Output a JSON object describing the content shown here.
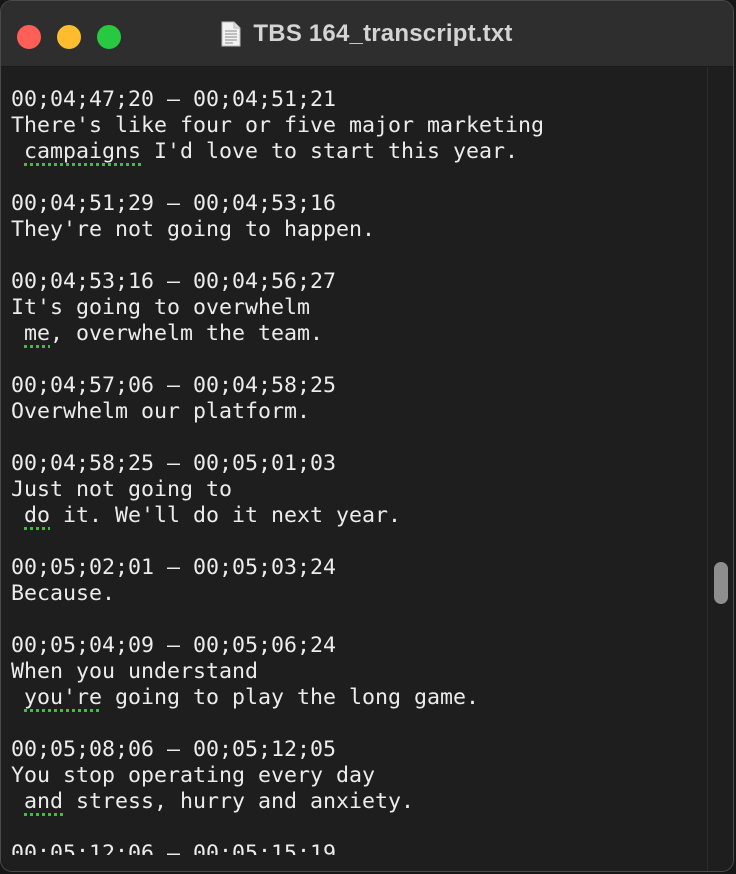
{
  "window": {
    "title": "TBS 164_transcript.txt"
  },
  "icons": {
    "document": "text-document-icon",
    "close": "close-icon",
    "minimize": "minimize-icon",
    "zoom": "zoom-icon"
  },
  "colors": {
    "close": "#ff5f57",
    "minimize": "#febc2e",
    "zoom": "#28c840",
    "spellcheck_underline": "#3fbf3f",
    "text": "#ececec",
    "background": "#1e1e1e"
  },
  "entries": [
    {
      "time": "00;04;47;20 – 00;04;51;21",
      "line1": "There's like four or five major marketing",
      "line2_word": "campaigns",
      "line2_rest": " I'd love to start this year."
    },
    {
      "time": "00;04;51;29 – 00;04;53;16",
      "line1": "They're not going to happen."
    },
    {
      "time": "00;04;53;16 – 00;04;56;27",
      "line1": "It's going to overwhelm",
      "line2_word": "me",
      "line2_rest": ", overwhelm the team."
    },
    {
      "time": "00;04;57;06 – 00;04;58;25",
      "line1": "Overwhelm our platform."
    },
    {
      "time": "00;04;58;25 – 00;05;01;03",
      "line1": "Just not going to",
      "line2_word": "do",
      "line2_rest": " it. We'll do it next year."
    },
    {
      "time": "00;05;02;01 – 00;05;03;24",
      "line1": "Because."
    },
    {
      "time": "00;05;04;09 – 00;05;06;24",
      "line1": "When you understand",
      "line2_word": "you're",
      "line2_rest": " going to play the long game."
    },
    {
      "time": "00;05;08;06 – 00;05;12;05",
      "line1": "You stop operating every day",
      "line2_word": "and",
      "line2_rest": " stress, hurry and anxiety."
    }
  ],
  "partial_next_line": "00;05;12;06 – 00;05;15;19"
}
